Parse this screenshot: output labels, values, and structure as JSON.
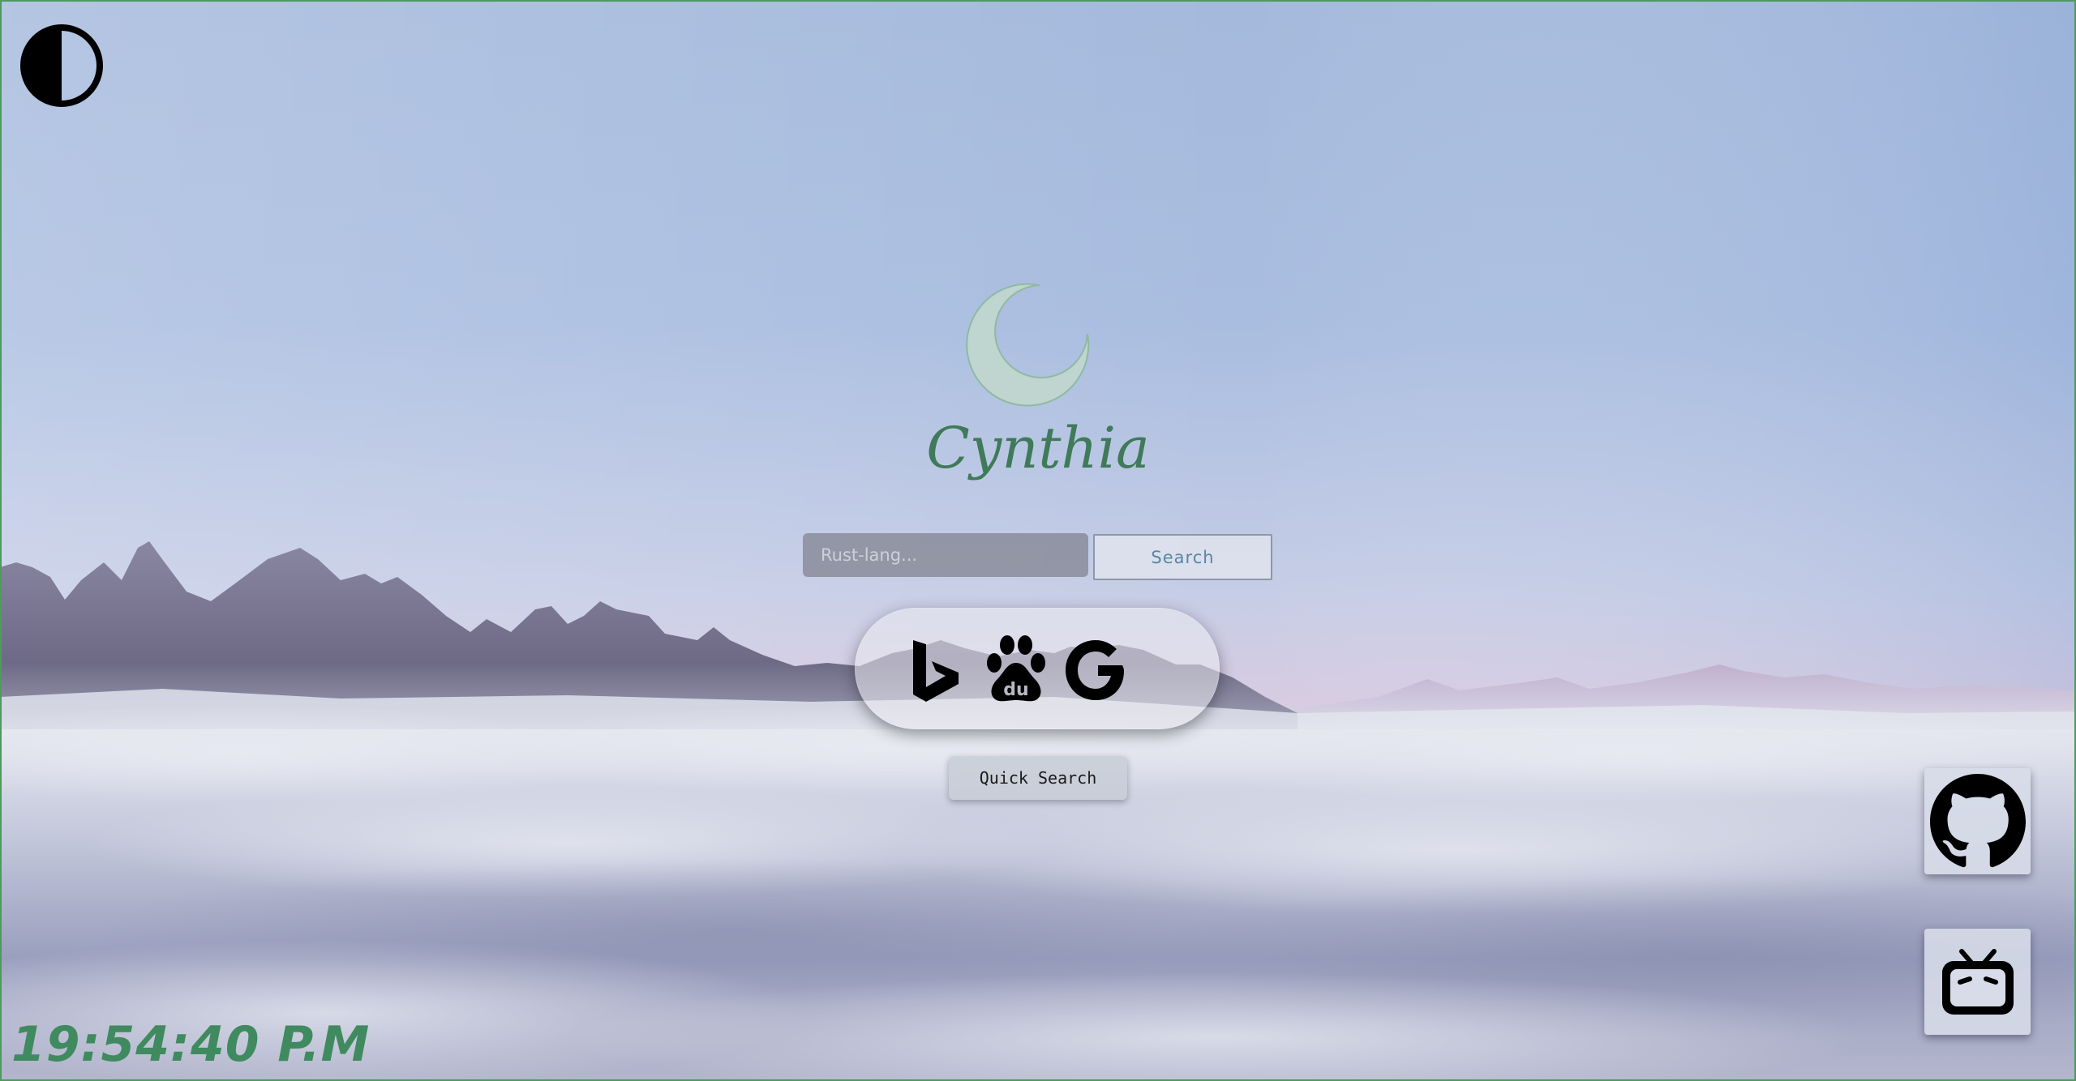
{
  "app": {
    "brand_name": "Cynthia",
    "accent_color": "#3f7a59"
  },
  "search": {
    "placeholder": "Rust-lang...",
    "value": "",
    "button_label": "Search"
  },
  "engines": [
    {
      "name": "Bing",
      "icon": "bing-icon"
    },
    {
      "name": "Baidu",
      "icon": "baidu-icon"
    },
    {
      "name": "Google",
      "icon": "google-icon"
    }
  ],
  "quick_search": {
    "label": "Quick Search"
  },
  "side_links": [
    {
      "name": "GitHub",
      "icon": "github-icon"
    },
    {
      "name": "Bilibili",
      "icon": "bilibili-icon"
    }
  ],
  "clock": {
    "time": "19:54:40 P.M"
  },
  "icons": {
    "theme_toggle": "contrast-icon",
    "logo": "crescent-moon-icon"
  },
  "background": {
    "subject": "mountains-above-clouds",
    "sky_top": "#8fa9d6",
    "sky_horizon": "#d8c4dc",
    "clouds": "#c9cfe0"
  }
}
